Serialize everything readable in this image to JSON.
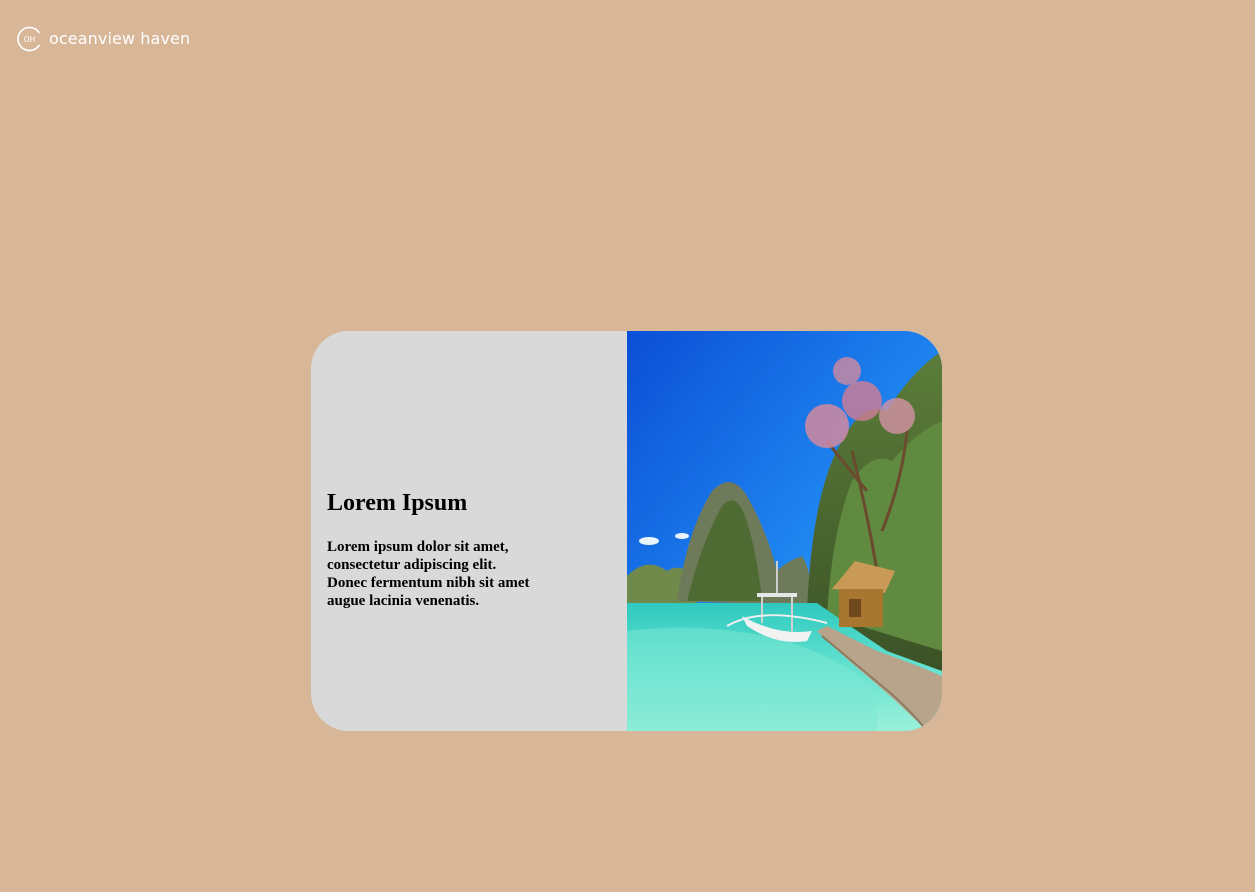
{
  "brand": {
    "logo_mark": "OH",
    "name": "oceanview haven"
  },
  "card": {
    "title": "Lorem Ipsum",
    "body": "Lorem ipsum dolor sit amet, consectetur adipiscing elit. Donec fermentum nibh sit amet augue lacinia venenatis.",
    "image_icon": "tropical-lagoon-photo"
  },
  "colors": {
    "background": "#d8b799",
    "card_panel": "#d9d9d9",
    "text": "#000000",
    "logo": "#ffffff"
  }
}
